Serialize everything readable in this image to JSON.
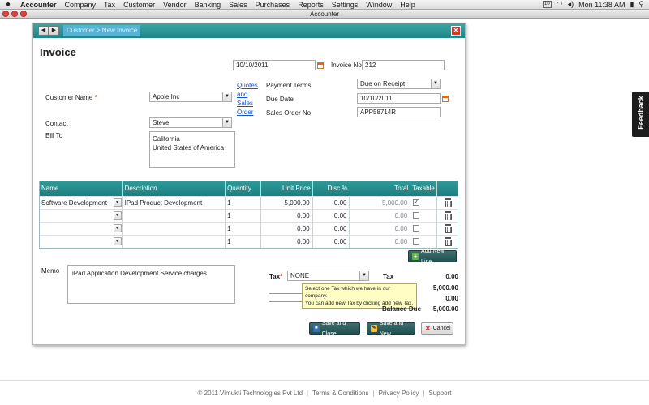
{
  "menubar": {
    "app": "Accounter",
    "items": [
      "Company",
      "Tax",
      "Customer",
      "Vendor",
      "Banking",
      "Sales",
      "Purchases",
      "Reports",
      "Settings",
      "Window",
      "Help"
    ],
    "calendar_badge": "10",
    "clock": "Mon 11:38 AM"
  },
  "window": {
    "title": "Accounter"
  },
  "dialog": {
    "breadcrumb": "Customer > New Invoice",
    "close_symbol": "✕",
    "title": "Invoice",
    "date": "10/10/2011",
    "invoice_no_label": "Invoice No",
    "invoice_no": "212",
    "customer_name_label": "Customer Name",
    "required_mark": "*",
    "customer_name": "Apple Inc",
    "quotes_link": [
      "Quotes",
      "and",
      "Sales",
      "Order"
    ],
    "contact_label": "Contact",
    "contact": "Steve",
    "bill_to_label": "Bill To",
    "bill_to_lines": [
      "California",
      "United States of America"
    ],
    "payment_terms_label": "Payment Terms",
    "payment_terms": "Due on Receipt",
    "due_date_label": "Due Date",
    "due_date": "10/10/2011",
    "sales_order_no_label": "Sales Order No",
    "sales_order_no": "APP58714R"
  },
  "grid": {
    "columns": [
      "Name",
      "Description",
      "Quantity",
      "Unit Price",
      "Disc %",
      "Total",
      "Taxable"
    ],
    "rows": [
      {
        "name": "Software Development",
        "description": "IPad Product Development",
        "quantity": "1",
        "unit_price": "5,000.00",
        "disc": "0.00",
        "total": "5,000.00",
        "taxable": true
      },
      {
        "name": "",
        "description": "",
        "quantity": "1",
        "unit_price": "0.00",
        "disc": "0.00",
        "total": "0.00",
        "taxable": false
      },
      {
        "name": "",
        "description": "",
        "quantity": "1",
        "unit_price": "0.00",
        "disc": "0.00",
        "total": "0.00",
        "taxable": false
      },
      {
        "name": "",
        "description": "",
        "quantity": "1",
        "unit_price": "0.00",
        "disc": "0.00",
        "total": "0.00",
        "taxable": false
      }
    ],
    "add_line_label": "Add New Line"
  },
  "memo": {
    "label": "Memo",
    "text": "iPad Application Development Service charges"
  },
  "tax": {
    "label": "Tax",
    "required_mark": "*",
    "value": "NONE",
    "tooltip_lines": [
      "Select one Tax which we have in our company.",
      "You can add new Tax by clicking add new Tax."
    ]
  },
  "totals": {
    "tax_label": "Tax",
    "tax_value": "0.00",
    "subtotal_value": "5,000.00",
    "paid_value": "0.00",
    "balance_due_label": "Balance Due",
    "balance_due_value": "5,000.00"
  },
  "buttons": {
    "save_close": "Save and Close",
    "save_new": "Save and New",
    "cancel": "Cancel"
  },
  "feedback_label": "Feedback",
  "footer": {
    "copyright": "© 2011 Vimukti Technologies Pvt Ltd",
    "links": [
      "Terms & Conditions",
      "Privacy Policy",
      "Support"
    ]
  }
}
